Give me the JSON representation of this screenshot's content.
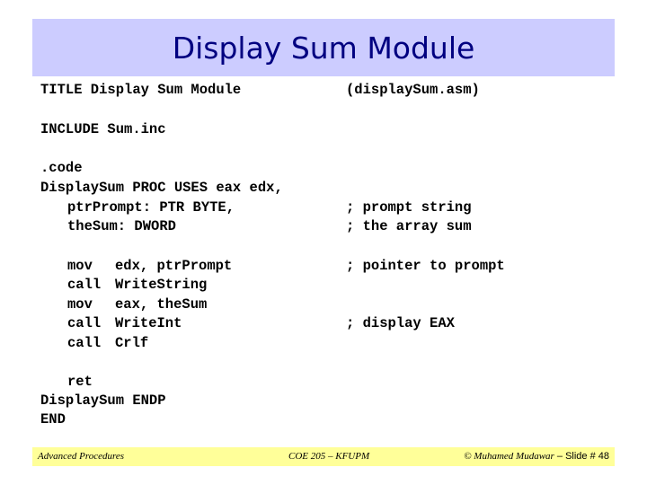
{
  "slide": {
    "title": "Display Sum Module"
  },
  "code": {
    "title_line": "TITLE Display Sum Module",
    "file_comment": "(displaySum.asm)",
    "include_line": "INCLUDE Sum.inc",
    "code_directive": ".code",
    "proc_line": "DisplaySum PROC USES eax edx,",
    "param1": "ptrPrompt: PTR BYTE,",
    "param1_comment": "; prompt string",
    "param2": "theSum: DWORD",
    "param2_comment": "; the array sum",
    "instructions": [
      {
        "op": "mov",
        "args": "edx, ptrPrompt",
        "comment": "; pointer to prompt"
      },
      {
        "op": "call",
        "args": "WriteString",
        "comment": ""
      },
      {
        "op": "mov",
        "args": "eax, theSum",
        "comment": ""
      },
      {
        "op": "call",
        "args": "WriteInt",
        "comment": "; display EAX"
      },
      {
        "op": "call",
        "args": "Crlf",
        "comment": ""
      }
    ],
    "ret_line": "ret",
    "endp_line": "DisplaySum ENDP",
    "end_line": "END"
  },
  "footer": {
    "left": "Advanced Procedures",
    "center": "COE 205 – KFUPM",
    "right_author": "© Muhamed Mudawar",
    "right_slide": " – Slide # 48"
  }
}
